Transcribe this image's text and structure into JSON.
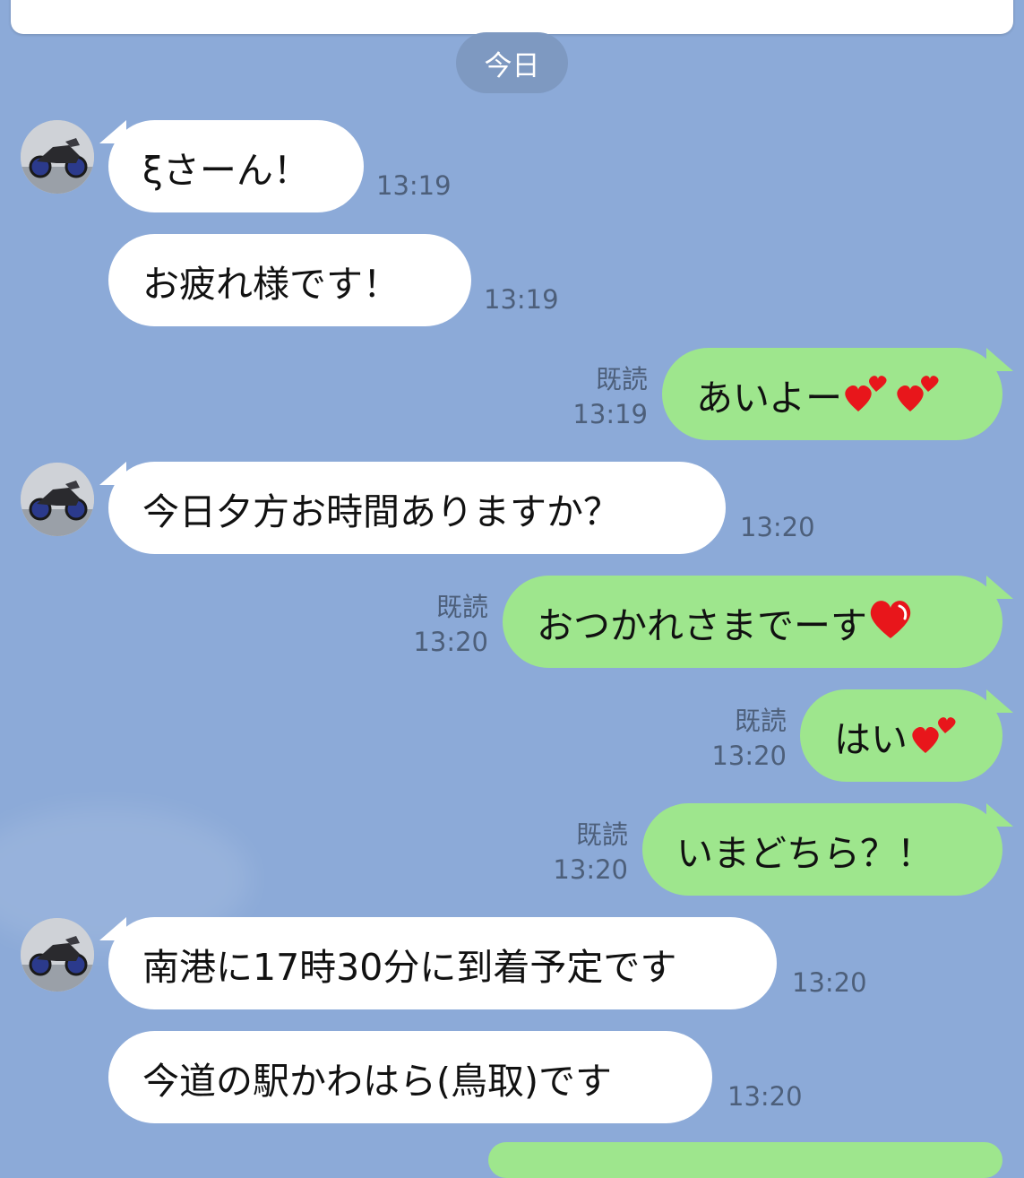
{
  "date_label": "今日",
  "messages": [
    {
      "dir": "in",
      "text": "ξさーん！",
      "time": "13:19"
    },
    {
      "dir": "in",
      "text": "お疲れ様です！",
      "time": "13:19"
    },
    {
      "dir": "out",
      "text": "あいよー",
      "read": "既読",
      "time": "13:19",
      "emoji": "two-hearts-icon"
    },
    {
      "dir": "in",
      "text": "今日夕方お時間ありますか？",
      "time": "13:20"
    },
    {
      "dir": "out",
      "text": "おつかれさまでーす",
      "read": "既読",
      "time": "13:20",
      "emoji": "heart-icon"
    },
    {
      "dir": "out",
      "text": "はい",
      "read": "既読",
      "time": "13:20",
      "emoji": "two-hearts-icon"
    },
    {
      "dir": "out",
      "text": "いまどちら？！",
      "read": "既読",
      "time": "13:20"
    },
    {
      "dir": "in",
      "text": "南港に17時30分に到着予定です",
      "time": "13:20"
    },
    {
      "dir": "in",
      "text": "今道の駅かわはら(鳥取)です",
      "time": "13:20"
    }
  ],
  "colors": {
    "background": "#8caad8",
    "incoming_bubble": "#ffffff",
    "outgoing_bubble": "#9ee68d",
    "heart": "#e8161b"
  }
}
